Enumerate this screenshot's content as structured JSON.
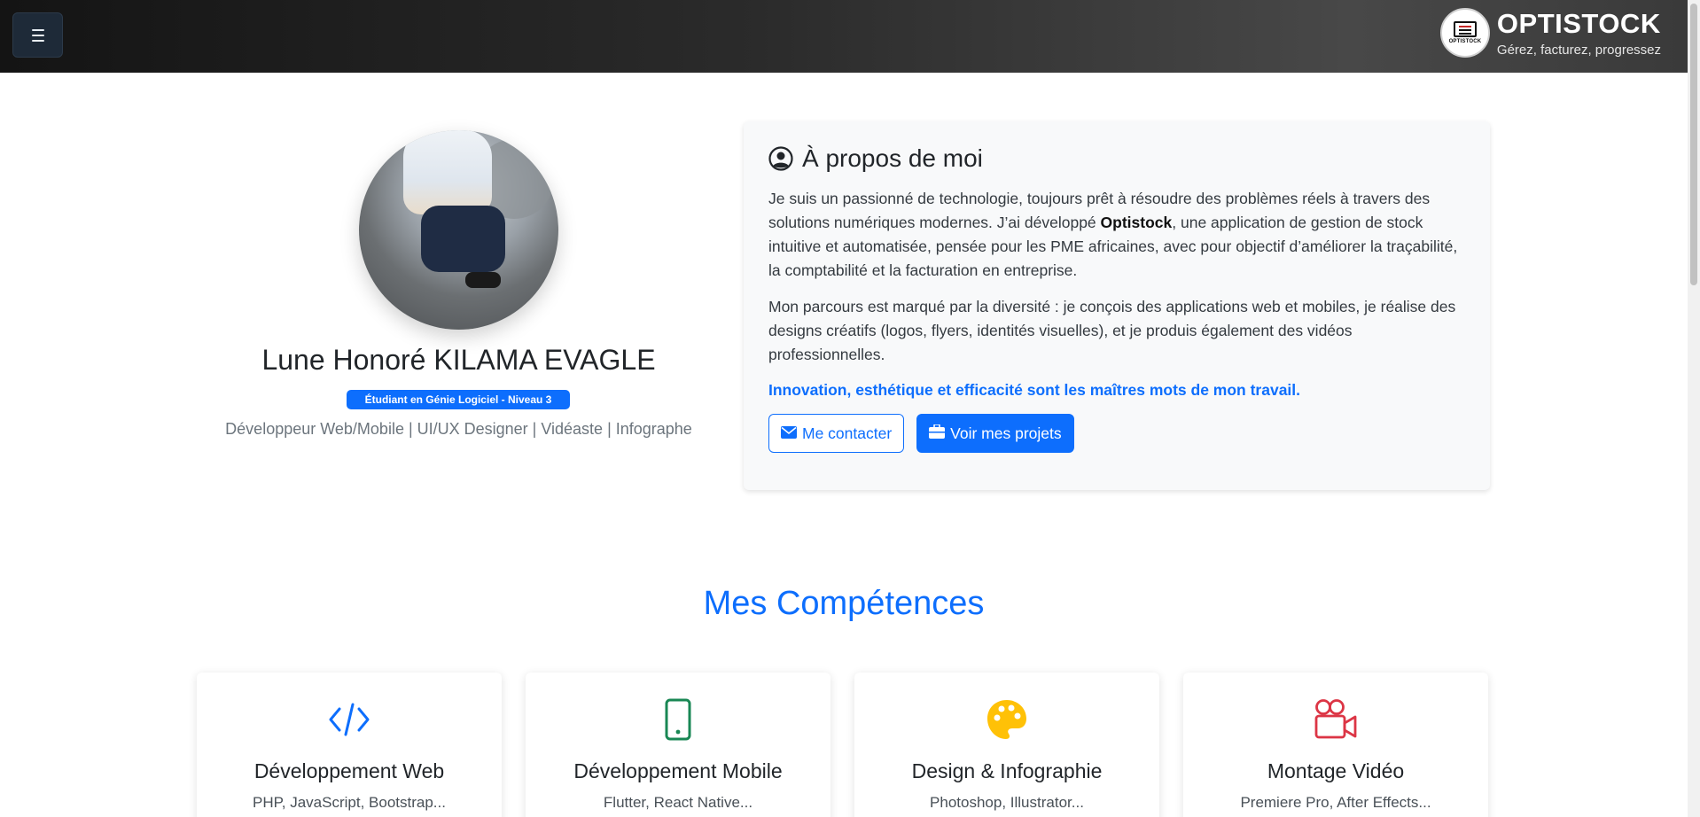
{
  "navbar": {
    "brand_title": "OPTISTOCK",
    "brand_subtitle": "Gérez, facturez, progressez",
    "logo_text": "OPTISTOCK"
  },
  "profile": {
    "name": "Lune Honoré KILAMA EVAGLE",
    "badge": "Étudiant en Génie Logiciel - Niveau 3",
    "roles": "Développeur Web/Mobile | UI/UX Designer | Vidéaste | Infographe"
  },
  "about": {
    "title": "À propos de moi",
    "p1_before": "Je suis un passionné de technologie, toujours prêt à résoudre des problèmes réels à travers des solutions numériques modernes. J’ai développé ",
    "p1_strong": "Optistock",
    "p1_after": ", une application de gestion de stock intuitive et automatisée, pensée pour les PME africaines, avec pour objectif d’améliorer la traçabilité, la comptabilité et la facturation en entreprise.",
    "p2": "Mon parcours est marqué par la diversité : je conçois des applications web et mobiles, je réalise des designs créatifs (logos, flyers, identités visuelles), et je produis également des vidéos professionnelles.",
    "motto": "Innovation, esthétique et efficacité sont les maîtres mots de mon travail.",
    "contact_label": "Me contacter",
    "projects_label": "Voir mes projets"
  },
  "skills": {
    "title": "Mes Compétences",
    "items": [
      {
        "title": "Développement Web",
        "desc": "PHP, JavaScript, Bootstrap...",
        "icon": "code-icon",
        "color": "#0d6efd"
      },
      {
        "title": "Développement Mobile",
        "desc": "Flutter, React Native...",
        "icon": "phone-icon",
        "color": "#198754"
      },
      {
        "title": "Design & Infographie",
        "desc": "Photoshop, Illustrator...",
        "icon": "palette-icon",
        "color": "#ffc107"
      },
      {
        "title": "Montage Vidéo",
        "desc": "Premiere Pro, After Effects...",
        "icon": "camera-reels-icon",
        "color": "#dc3545"
      }
    ]
  }
}
